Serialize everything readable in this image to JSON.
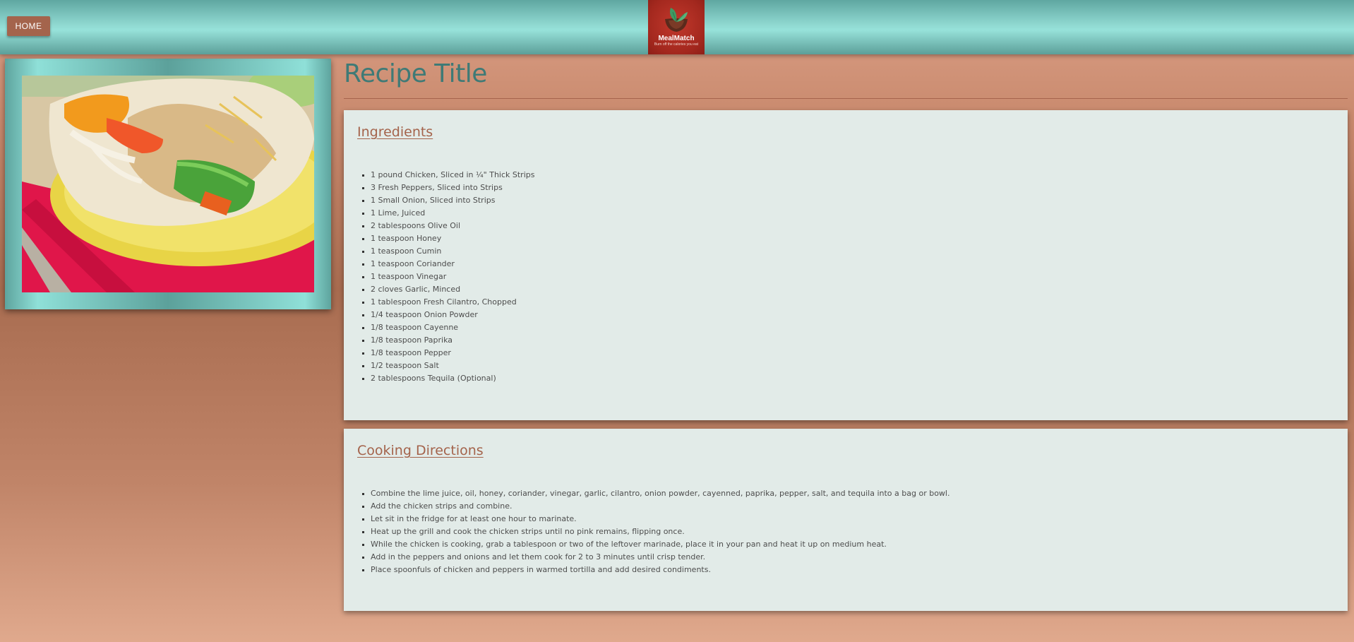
{
  "nav": {
    "home_label": "HOME"
  },
  "logo": {
    "name": "MealMatch",
    "tagline": "Burn off the calories you eat",
    "colors": {
      "background": "#a3281e",
      "leaf": "#3f9a63",
      "bowl": "#5a2a1c"
    }
  },
  "recipe": {
    "title": "Recipe Title",
    "image_icon": "fajita-photo"
  },
  "ingredients": {
    "heading": "Ingredients",
    "items": [
      "1 pound Chicken, Sliced in ¼\" Thick Strips",
      "3 Fresh Peppers, Sliced into Strips",
      "1 Small Onion, Sliced into Strips",
      "1 Lime, Juiced",
      "2 tablespoons Olive Oil",
      "1 teaspoon Honey",
      "1 teaspoon Cumin",
      "1 teaspoon Coriander",
      "1 teaspoon Vinegar",
      "2 cloves Garlic, Minced",
      "1 tablespoon Fresh Cilantro, Chopped",
      "1/4 teaspoon Onion Powder",
      "1/8 teaspoon Cayenne",
      "1/8 teaspoon Paprika",
      "1/8 teaspoon Pepper",
      "1/2 teaspoon Salt",
      "2 tablespoons Tequila (Optional)"
    ]
  },
  "directions": {
    "heading": "Cooking Directions",
    "items": [
      "Combine the lime juice, oil, honey, coriander, vinegar, garlic, cilantro, onion powder, cayenned, paprika, pepper, salt, and tequila into a bag or bowl.",
      "Add the chicken strips and combine.",
      "Let sit in the fridge for at least one hour to marinate.",
      "Heat up the grill and cook the chicken strips until no pink remains, flipping once.",
      "While the chicken is cooking, grab a tablespoon or two of the leftover marinade, place it in your pan and heat it up on medium heat.",
      "Add in the peppers and onions and let them cook for 2 to 3 minutes until crisp tender.",
      "Place spoonfuls of chicken and peppers in warmed tortilla and add desired condiments."
    ]
  },
  "theme": {
    "accent": "#a4644c",
    "teal": "#8fd8d0",
    "title_color": "#3f7a76",
    "card_bg": "#e2ebe8"
  }
}
